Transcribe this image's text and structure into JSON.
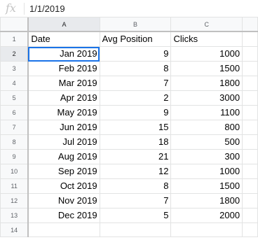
{
  "formula_bar": {
    "fx_icon": "fx-icon",
    "value": "1/1/2019"
  },
  "columns": [
    "A",
    "B",
    "C"
  ],
  "row_numbers": [
    "1",
    "2",
    "3",
    "4",
    "5",
    "6",
    "7",
    "8",
    "9",
    "10",
    "11",
    "12",
    "13",
    "14"
  ],
  "headers": [
    "Date",
    "Avg Position",
    "Clicks"
  ],
  "rows": [
    {
      "date": "Jan 2019",
      "avg_position": "9",
      "clicks": "1000"
    },
    {
      "date": "Feb 2019",
      "avg_position": "8",
      "clicks": "1500"
    },
    {
      "date": "Mar 2019",
      "avg_position": "7",
      "clicks": "1800"
    },
    {
      "date": "Apr 2019",
      "avg_position": "2",
      "clicks": "3000"
    },
    {
      "date": "May 2019",
      "avg_position": "9",
      "clicks": "1100"
    },
    {
      "date": "Jun 2019",
      "avg_position": "15",
      "clicks": "800"
    },
    {
      "date": "Jul 2019",
      "avg_position": "18",
      "clicks": "500"
    },
    {
      "date": "Aug 2019",
      "avg_position": "21",
      "clicks": "300"
    },
    {
      "date": "Sep 2019",
      "avg_position": "12",
      "clicks": "1000"
    },
    {
      "date": "Oct 2019",
      "avg_position": "8",
      "clicks": "1500"
    },
    {
      "date": "Nov 2019",
      "avg_position": "7",
      "clicks": "1800"
    },
    {
      "date": "Dec 2019",
      "avg_position": "5",
      "clicks": "2000"
    }
  ],
  "colors": {
    "selection": "#1a73e8",
    "gridline": "#e2e3e3",
    "header_bg": "#f8f9fa"
  }
}
